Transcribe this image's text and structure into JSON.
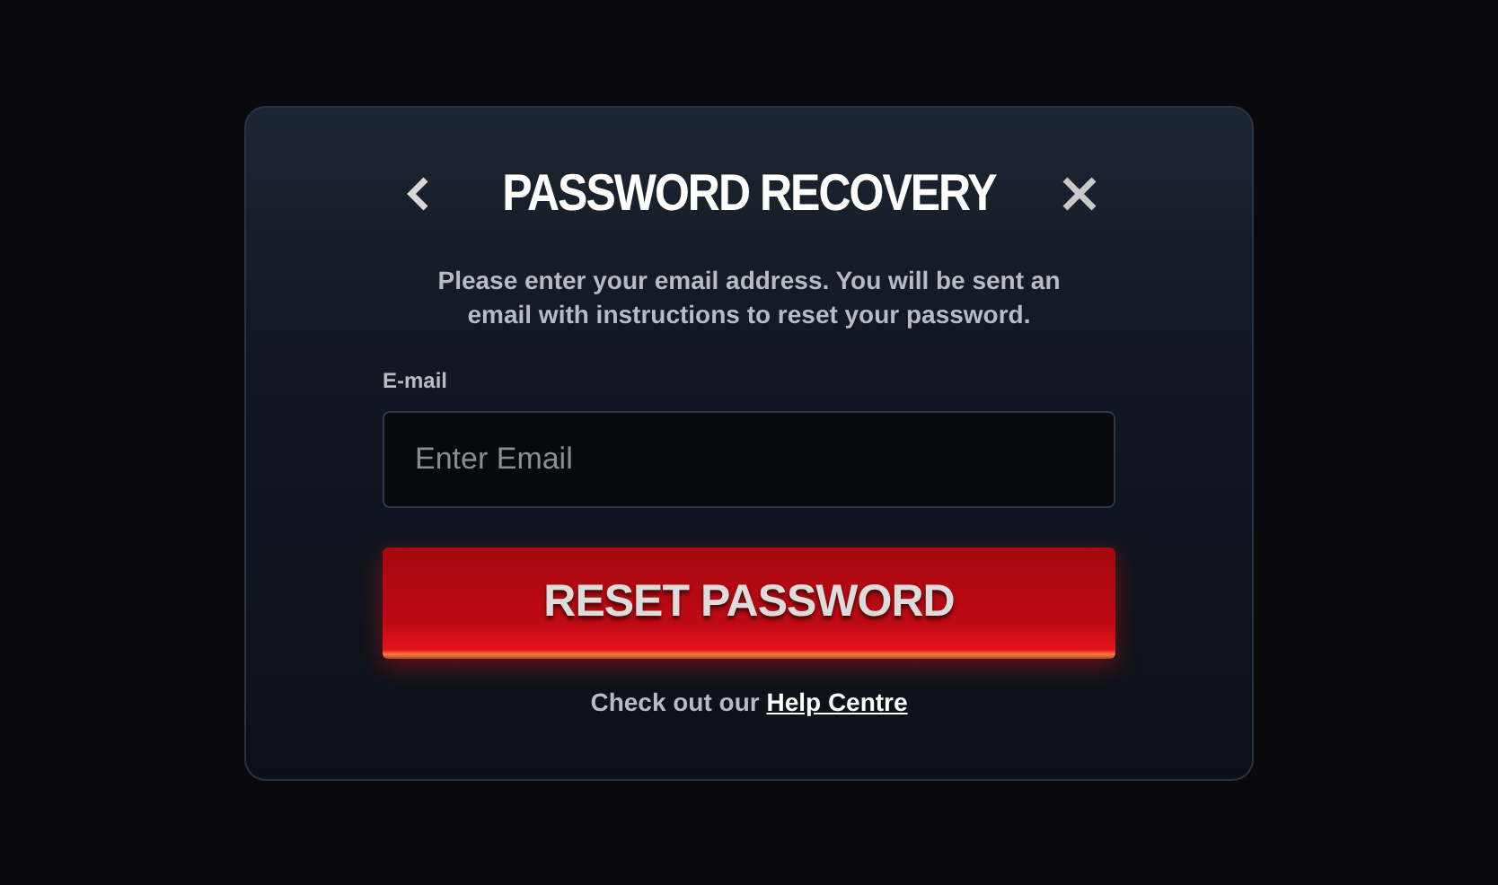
{
  "dialog": {
    "title": "PASSWORD RECOVERY",
    "description": "Please enter your email address. You will be sent an email with instructions to reset your password."
  },
  "email_field": {
    "label": "E-mail",
    "placeholder": "Enter Email"
  },
  "submit_button": {
    "label": "RESET PASSWORD"
  },
  "footer": {
    "text": "Check out our ",
    "link": "Help Centre"
  }
}
